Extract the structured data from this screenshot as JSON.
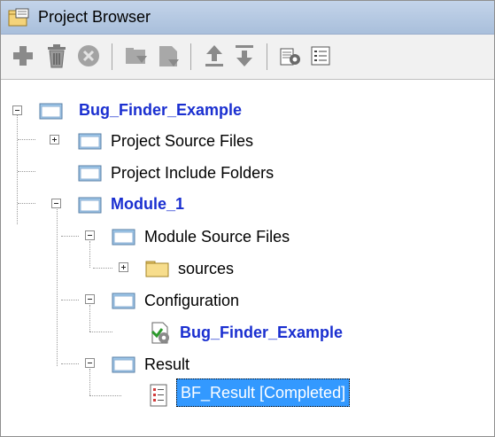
{
  "window": {
    "title": "Project Browser"
  },
  "toolbar": {
    "buttons": [
      {
        "icon": "add-icon"
      },
      {
        "icon": "delete-icon"
      },
      {
        "icon": "stop-icon"
      },
      {
        "icon": "folder-action-icon"
      },
      {
        "icon": "folder-move-icon"
      },
      {
        "icon": "move-up-icon"
      },
      {
        "icon": "move-down-icon"
      },
      {
        "icon": "configure-icon"
      },
      {
        "icon": "list-icon"
      }
    ]
  },
  "tree": {
    "project": "Bug_Finder_Example",
    "project_source_files": "Project Source Files",
    "project_include_folders": "Project Include Folders",
    "module": "Module_1",
    "module_source_files": "Module Source Files",
    "sources": "sources",
    "configuration": "Configuration",
    "configuration_item": "Bug_Finder_Example",
    "result": "Result",
    "result_item": "BF_Result [Completed]"
  },
  "colors": {
    "title_bg": "#b5c8e2",
    "folder_blue": "#7fb3dc",
    "bold_link": "#1a2fd0",
    "selection": "#3399ff"
  }
}
